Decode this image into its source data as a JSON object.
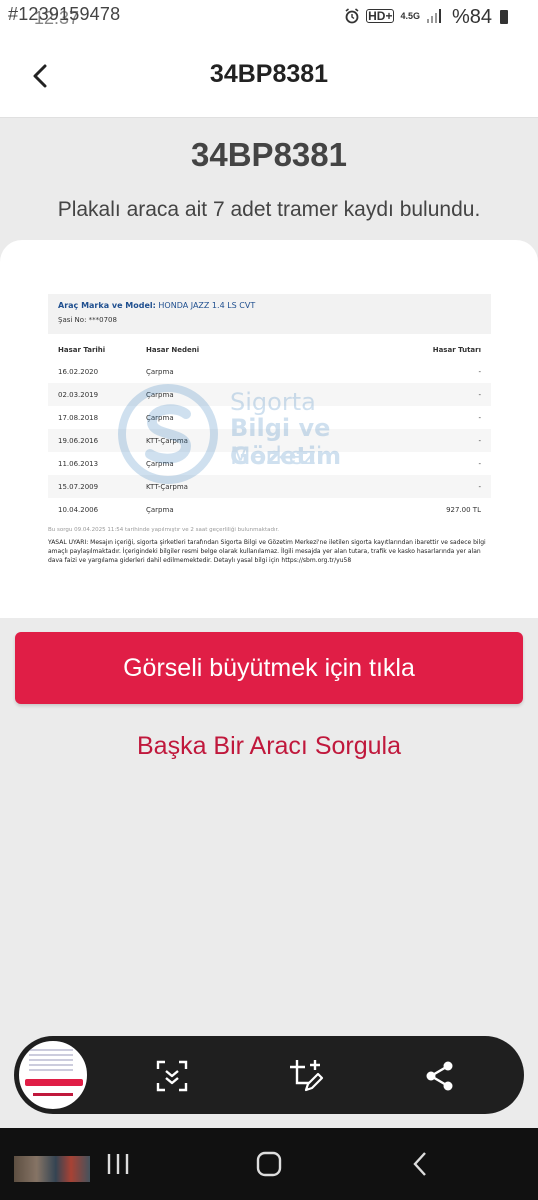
{
  "status_bar": {
    "overlay_id": "#1239159478",
    "time": "12:37",
    "network": "4.5G",
    "battery": "%84"
  },
  "header": {
    "title": "34BP8381"
  },
  "main": {
    "plate": "34BP8381",
    "subtitle": "Plakalı araca ait 7 adet tramer kaydı bulundu.",
    "report": {
      "brand_label": "Araç Marka ve Model:",
      "brand_value": "HONDA JAZZ 1.4 LS CVT",
      "chassis": "Şasi No: ***0708",
      "columns": [
        "Hasar Tarihi",
        "Hasar Nedeni",
        "Hasar Tutarı"
      ],
      "rows": [
        {
          "date": "16.02.2020",
          "reason": "Çarpma",
          "amount": "-"
        },
        {
          "date": "02.03.2019",
          "reason": "Çarpma",
          "amount": "-"
        },
        {
          "date": "17.08.2018",
          "reason": "Çarpma",
          "amount": "-"
        },
        {
          "date": "19.06.2016",
          "reason": "KTT-Çarpma",
          "amount": "-"
        },
        {
          "date": "11.06.2013",
          "reason": "Çarpma",
          "amount": "-"
        },
        {
          "date": "15.07.2009",
          "reason": "KTT-Çarpma",
          "amount": "-"
        },
        {
          "date": "10.04.2006",
          "reason": "Çarpma",
          "amount": "927.00 TL"
        }
      ],
      "logo_lines": [
        "Sigorta",
        "Bilgi ve Gözetim",
        "Merkezi"
      ],
      "note": "Bu sorgu 09.04.2025 11:54 tarihinde yapılmıştır ve 2 saat geçerliliği bulunmaktadır.",
      "legal": "YASAL UYARI: Mesajın içeriği, sigorta şirketleri tarafından Sigorta Bilgi ve Gözetim Merkezi'ne iletilen sigorta kayıtlarından ibarettir ve sadece bilgi amaçlı paylaşılmaktadır. İçerigindeki bilgiler resmi belge olarak kullanılamaz. İlgili mesajda yer alan tutara, trafik ve kasko hasarlarında yer alan dava faizi ve yargılama giderleri dahil edilmemektedir. Detaylı yasal bilgi için https://sbm.org.tr/yu58"
    },
    "enlarge_button": "Görseli büyütmek için tıkla",
    "another_link": "Başka Bir Aracı Sorgula"
  },
  "toolbar": {
    "icons": [
      "scroll-capture-icon",
      "crop-edit-icon",
      "share-icon"
    ]
  },
  "colors": {
    "accent": "#e01e46",
    "link": "#c0183c",
    "background": "#ebebeb"
  }
}
